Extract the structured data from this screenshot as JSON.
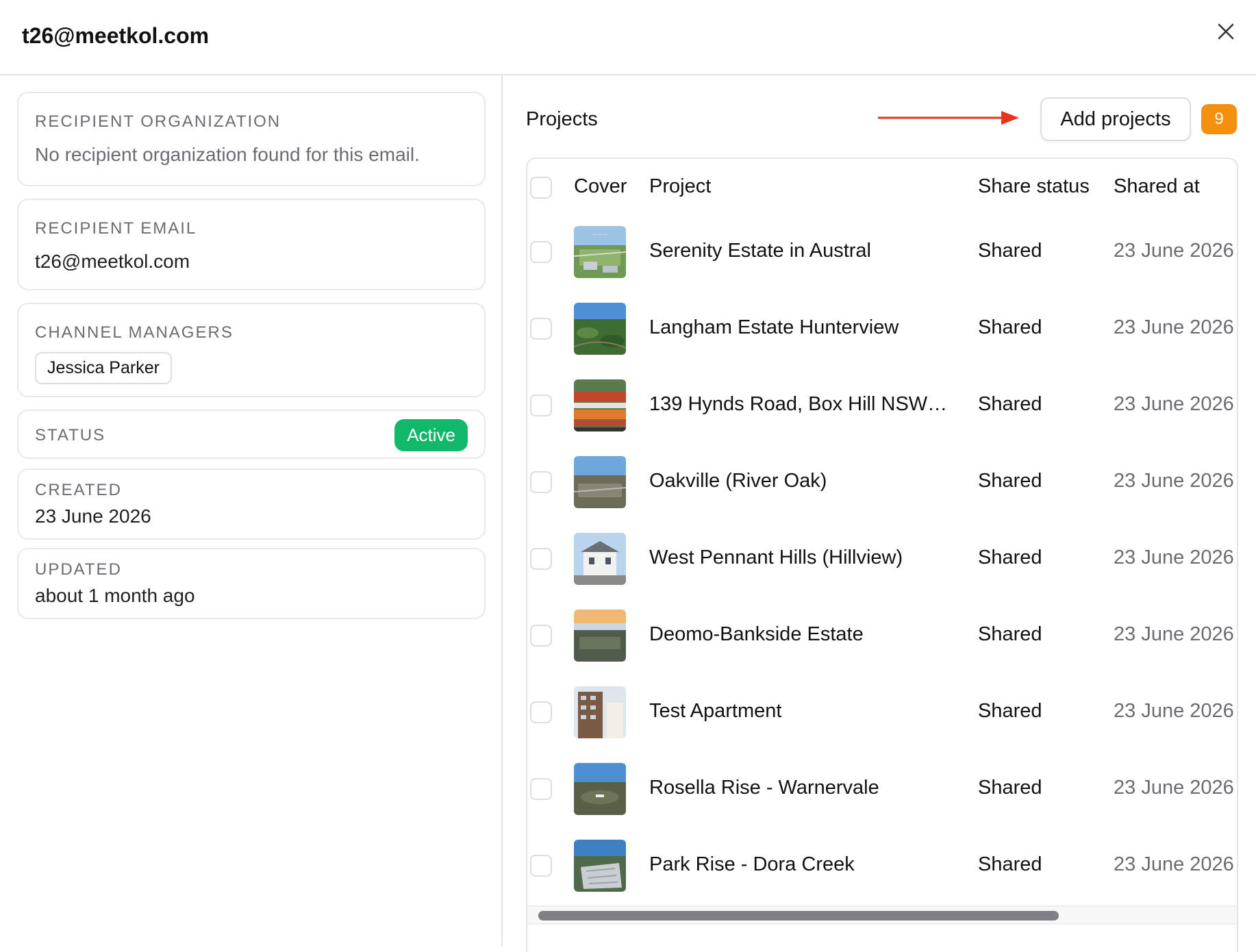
{
  "header": {
    "title": "t26@meetkol.com"
  },
  "recipient_organization": {
    "label": "RECIPIENT ORGANIZATION",
    "value": "No recipient organization found for this email."
  },
  "recipient_email": {
    "label": "RECIPIENT EMAIL",
    "value": "t26@meetkol.com"
  },
  "channel_managers": {
    "label": "CHANNEL MANAGERS",
    "managers": [
      "Jessica Parker"
    ]
  },
  "status": {
    "label": "STATUS",
    "value": "Active",
    "color": "#11b86a"
  },
  "created": {
    "label": "CREATED",
    "value": "23 June 2026"
  },
  "updated": {
    "label": "UPDATED",
    "value": "about 1 month ago"
  },
  "projects": {
    "title": "Projects",
    "add_button_label": "Add projects",
    "count": "9",
    "count_color": "#f5900f",
    "arrow_color": "#e8321c",
    "columns": [
      "Cover",
      "Project",
      "Share status",
      "Shared at"
    ],
    "rows": [
      {
        "project": "Serenity Estate in Austral",
        "status": "Shared",
        "shared_at": "23 June 2026",
        "cover": "aerial-estate"
      },
      {
        "project": "Langham Estate Hunterview",
        "status": "Shared",
        "shared_at": "23 June 2026",
        "cover": "aerial-forest"
      },
      {
        "project": "139 Hynds Road, Box Hill NSW 2...",
        "status": "Shared",
        "shared_at": "23 June 2026",
        "cover": "site-plan"
      },
      {
        "project": "Oakville (River Oak)",
        "status": "Shared",
        "shared_at": "23 June 2026",
        "cover": "aerial-suburb"
      },
      {
        "project": "West Pennant Hills (Hillview)",
        "status": "Shared",
        "shared_at": "23 June 2026",
        "cover": "house"
      },
      {
        "project": "Deomo-Bankside Estate",
        "status": "Shared",
        "shared_at": "23 June 2026",
        "cover": "sunset-aerial"
      },
      {
        "project": "Test Apartment",
        "status": "Shared",
        "shared_at": "23 June 2026",
        "cover": "apartment"
      },
      {
        "project": "Rosella Rise - Warnervale",
        "status": "Shared",
        "shared_at": "23 June 2026",
        "cover": "aerial-hills"
      },
      {
        "project": "Park Rise - Dora Creek",
        "status": "Shared",
        "shared_at": "23 June 2026",
        "cover": "aerial-lake"
      }
    ]
  }
}
